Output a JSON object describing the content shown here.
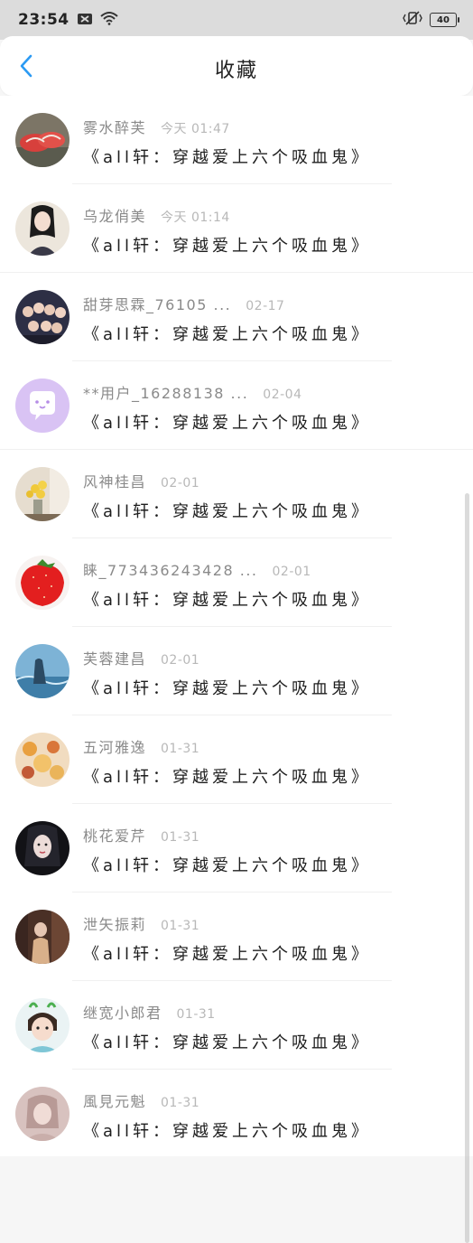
{
  "status_bar": {
    "time": "23:54",
    "battery": "40"
  },
  "header": {
    "title": "收藏"
  },
  "items": [
    {
      "name": "雾水醉芙",
      "time": "今天 01:47",
      "title": "《all轩：穿越爱上六个吸血鬼》"
    },
    {
      "name": "乌龙俏美",
      "time": "今天 01:14",
      "title": "《all轩：穿越爱上六个吸血鬼》"
    },
    {
      "name": "甜芽思霖_76105 ...",
      "time": "02-17",
      "title": "《all轩：穿越爱上六个吸血鬼》"
    },
    {
      "name": "**用户_16288138 ...",
      "time": "02-04",
      "title": "《all轩：穿越爱上六个吸血鬼》"
    },
    {
      "name": "风神桂昌",
      "time": "02-01",
      "title": "《all轩：穿越爱上六个吸血鬼》"
    },
    {
      "name": "睐_773436243428 ...",
      "time": "02-01",
      "title": "《all轩：穿越爱上六个吸血鬼》"
    },
    {
      "name": "芙蓉建昌",
      "time": "02-01",
      "title": "《all轩：穿越爱上六个吸血鬼》"
    },
    {
      "name": "五河雅逸",
      "time": "01-31",
      "title": "《all轩：穿越爱上六个吸血鬼》"
    },
    {
      "name": "桃花爱芹",
      "time": "01-31",
      "title": "《all轩：穿越爱上六个吸血鬼》"
    },
    {
      "name": "泄矢振莉",
      "time": "01-31",
      "title": "《all轩：穿越爱上六个吸血鬼》"
    },
    {
      "name": "继宽小郎君",
      "time": "01-31",
      "title": "《all轩：穿越爱上六个吸血鬼》"
    },
    {
      "name": "風見元魁",
      "time": "01-31",
      "title": "《all轩：穿越爱上六个吸血鬼》"
    }
  ],
  "colors": {
    "accent": "#2b9af3",
    "title_text": "#1e1e1e",
    "name_text": "#8a8a8a",
    "time_text": "#b8b8b8"
  }
}
